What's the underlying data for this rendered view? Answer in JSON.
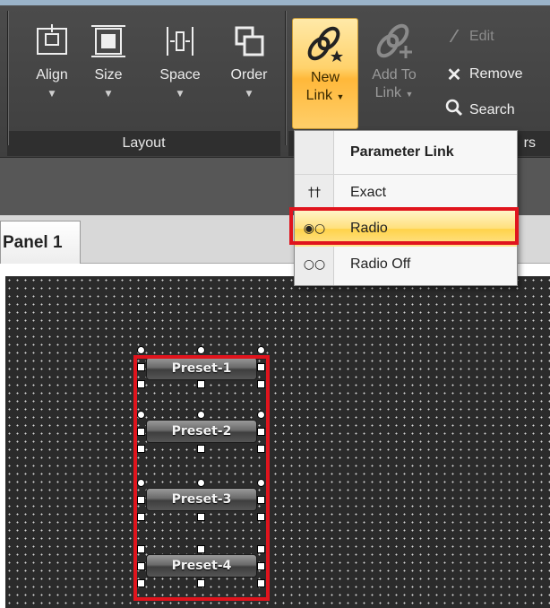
{
  "ribbon": {
    "layout_group": {
      "title": "Layout",
      "buttons": [
        {
          "label": "Align",
          "icon": "align-icon"
        },
        {
          "label": "Size",
          "icon": "size-icon"
        },
        {
          "label": "Space",
          "icon": "space-icon"
        },
        {
          "label": "Order",
          "icon": "order-icon"
        }
      ]
    },
    "link_group": {
      "title_partial": "rs",
      "new_link": {
        "line1": "New",
        "line2": "Link",
        "icon": "new-link-icon"
      },
      "add_to_link": {
        "line1": "Add To",
        "line2": "Link",
        "icon": "add-to-link-icon"
      },
      "edit": {
        "label": "Edit",
        "icon": "edit-icon"
      },
      "remove": {
        "label": "Remove",
        "icon": "remove-icon"
      },
      "search": {
        "label": "Search",
        "icon": "search-icon"
      }
    }
  },
  "tabs": [
    {
      "label": "Panel 1"
    }
  ],
  "dropdown": {
    "header": "Parameter Link",
    "items": [
      {
        "label": "Exact",
        "icon": "exact-link-icon",
        "glyph": "††"
      },
      {
        "label": "Radio",
        "icon": "radio-link-icon",
        "glyph": "◉○",
        "highlighted": true
      },
      {
        "label": "Radio Off",
        "icon": "radio-off-link-icon",
        "glyph": "○○"
      }
    ]
  },
  "canvas": {
    "presets": [
      {
        "label": "Preset-1"
      },
      {
        "label": "Preset-2"
      },
      {
        "label": "Preset-3"
      },
      {
        "label": "Preset-4"
      }
    ]
  },
  "colors": {
    "highlight_box": "#e0141d",
    "active_button": "#ffd26b",
    "ribbon_bg": "#4b4b4b",
    "canvas_bg": "#2b2b2b"
  }
}
